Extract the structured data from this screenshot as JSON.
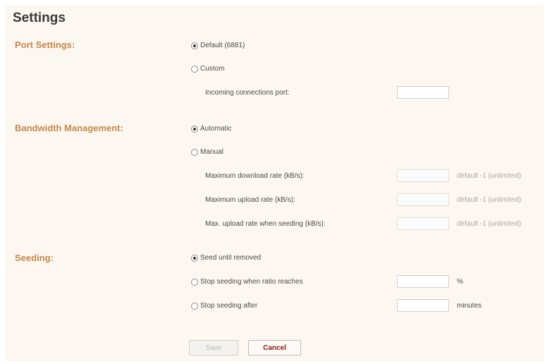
{
  "page": {
    "title": "Settings"
  },
  "port": {
    "section_label": "Port Settings:",
    "opt_default": "Default (6881)",
    "opt_custom": "Custom",
    "incoming_label": "Incoming connections port:",
    "incoming_value": ""
  },
  "bandwidth": {
    "section_label": "Bandwidth Management:",
    "opt_automatic": "Automatic",
    "opt_manual": "Manual",
    "rows": [
      {
        "label": "Maximum download rate (kB/s):",
        "value": "",
        "hint": "default -1 (unlimited)"
      },
      {
        "label": "Maximum upload rate (kB/s):",
        "value": "",
        "hint": "default -1 (unlimited)"
      },
      {
        "label": "Max. upload rate when seeding (kB/s):",
        "value": "",
        "hint": "default -1 (unlimited)"
      }
    ]
  },
  "seeding": {
    "section_label": "Seeding:",
    "opt_until_removed": "Seed until removed",
    "opt_ratio": "Stop seeding when ratio reaches",
    "ratio_unit": "%",
    "ratio_value": "",
    "opt_after": "Stop seeding after",
    "after_unit": "minutes",
    "after_value": ""
  },
  "buttons": {
    "save": "Save",
    "cancel": "Cancel"
  }
}
